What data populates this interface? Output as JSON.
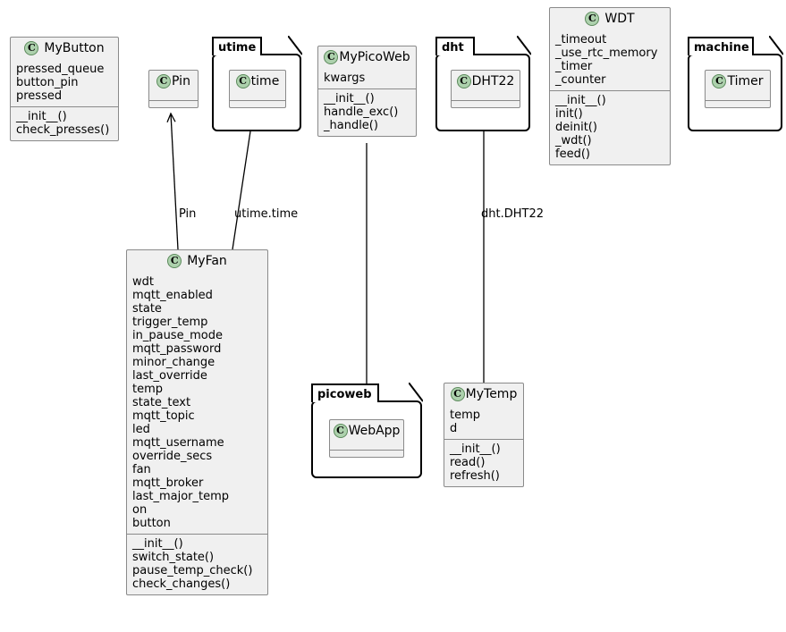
{
  "diagram": {
    "title": "UML class diagram",
    "style": {
      "class_fill": "#f0f0f0",
      "class_border": "#8a8a8a",
      "package_border": "#000000",
      "badge_fill": "#add1ad",
      "badge_border": "#5c8a5c",
      "edge_color": "#000000",
      "background": "#ffffff"
    },
    "badge_letter": "C"
  },
  "classes": [
    {
      "id": "mybutton",
      "name": "MyButton",
      "attributes": [
        "pressed_queue",
        "button_pin",
        "pressed"
      ],
      "methods": [
        "__init__()",
        "check_presses()"
      ]
    },
    {
      "id": "pin",
      "name": "Pin",
      "attributes": [],
      "methods": []
    },
    {
      "id": "time",
      "name": "time",
      "attributes": [],
      "methods": []
    },
    {
      "id": "mypicoweb",
      "name": "MyPicoWeb",
      "attributes": [
        "kwargs"
      ],
      "methods": [
        "__init__()",
        "handle_exc()",
        "_handle()"
      ]
    },
    {
      "id": "dht22",
      "name": "DHT22",
      "attributes": [],
      "methods": []
    },
    {
      "id": "wdt",
      "name": "WDT",
      "attributes": [
        "_timeout",
        "_use_rtc_memory",
        "_timer",
        "_counter"
      ],
      "methods": [
        "__init__()",
        "init()",
        "deinit()",
        "_wdt()",
        "feed()"
      ]
    },
    {
      "id": "timer",
      "name": "Timer",
      "attributes": [],
      "methods": []
    },
    {
      "id": "myfan",
      "name": "MyFan",
      "attributes": [
        "wdt",
        "mqtt_enabled",
        "state",
        "trigger_temp",
        "in_pause_mode",
        "mqtt_password",
        "minor_change",
        "last_override",
        "temp",
        "state_text",
        "mqtt_topic",
        "led",
        "mqtt_username",
        "override_secs",
        "fan",
        "mqtt_broker",
        "last_major_temp",
        "on",
        "button"
      ],
      "methods": [
        "__init__()",
        "switch_state()",
        "pause_temp_check()",
        "check_changes()"
      ]
    },
    {
      "id": "webapp",
      "name": "WebApp",
      "attributes": [],
      "methods": []
    },
    {
      "id": "mytemp",
      "name": "MyTemp",
      "attributes": [
        "temp",
        "d"
      ],
      "methods": [
        "__init__()",
        "read()",
        "refresh()"
      ]
    }
  ],
  "packages": [
    {
      "id": "utime",
      "name": "utime",
      "contains": "time"
    },
    {
      "id": "dht",
      "name": "dht",
      "contains": "DHT22"
    },
    {
      "id": "machine",
      "name": "machine",
      "contains": "Timer"
    },
    {
      "id": "picoweb",
      "name": "picoweb",
      "contains": "WebApp"
    }
  ],
  "relations": [
    {
      "id": "myfan-pin",
      "from": "MyFan",
      "to": "Pin",
      "label": "Pin",
      "arrow": "open"
    },
    {
      "id": "myfan-time",
      "from": "MyFan",
      "to": "time",
      "label": "utime.time",
      "arrow": "open"
    },
    {
      "id": "mytemp-dht22",
      "from": "MyTemp",
      "to": "DHT22",
      "label": "dht.DHT22",
      "arrow": "open"
    },
    {
      "id": "mypicoweb-webapp",
      "from": "MyPicoWeb",
      "to": "WebApp",
      "label": "",
      "arrow": "generalization"
    }
  ]
}
